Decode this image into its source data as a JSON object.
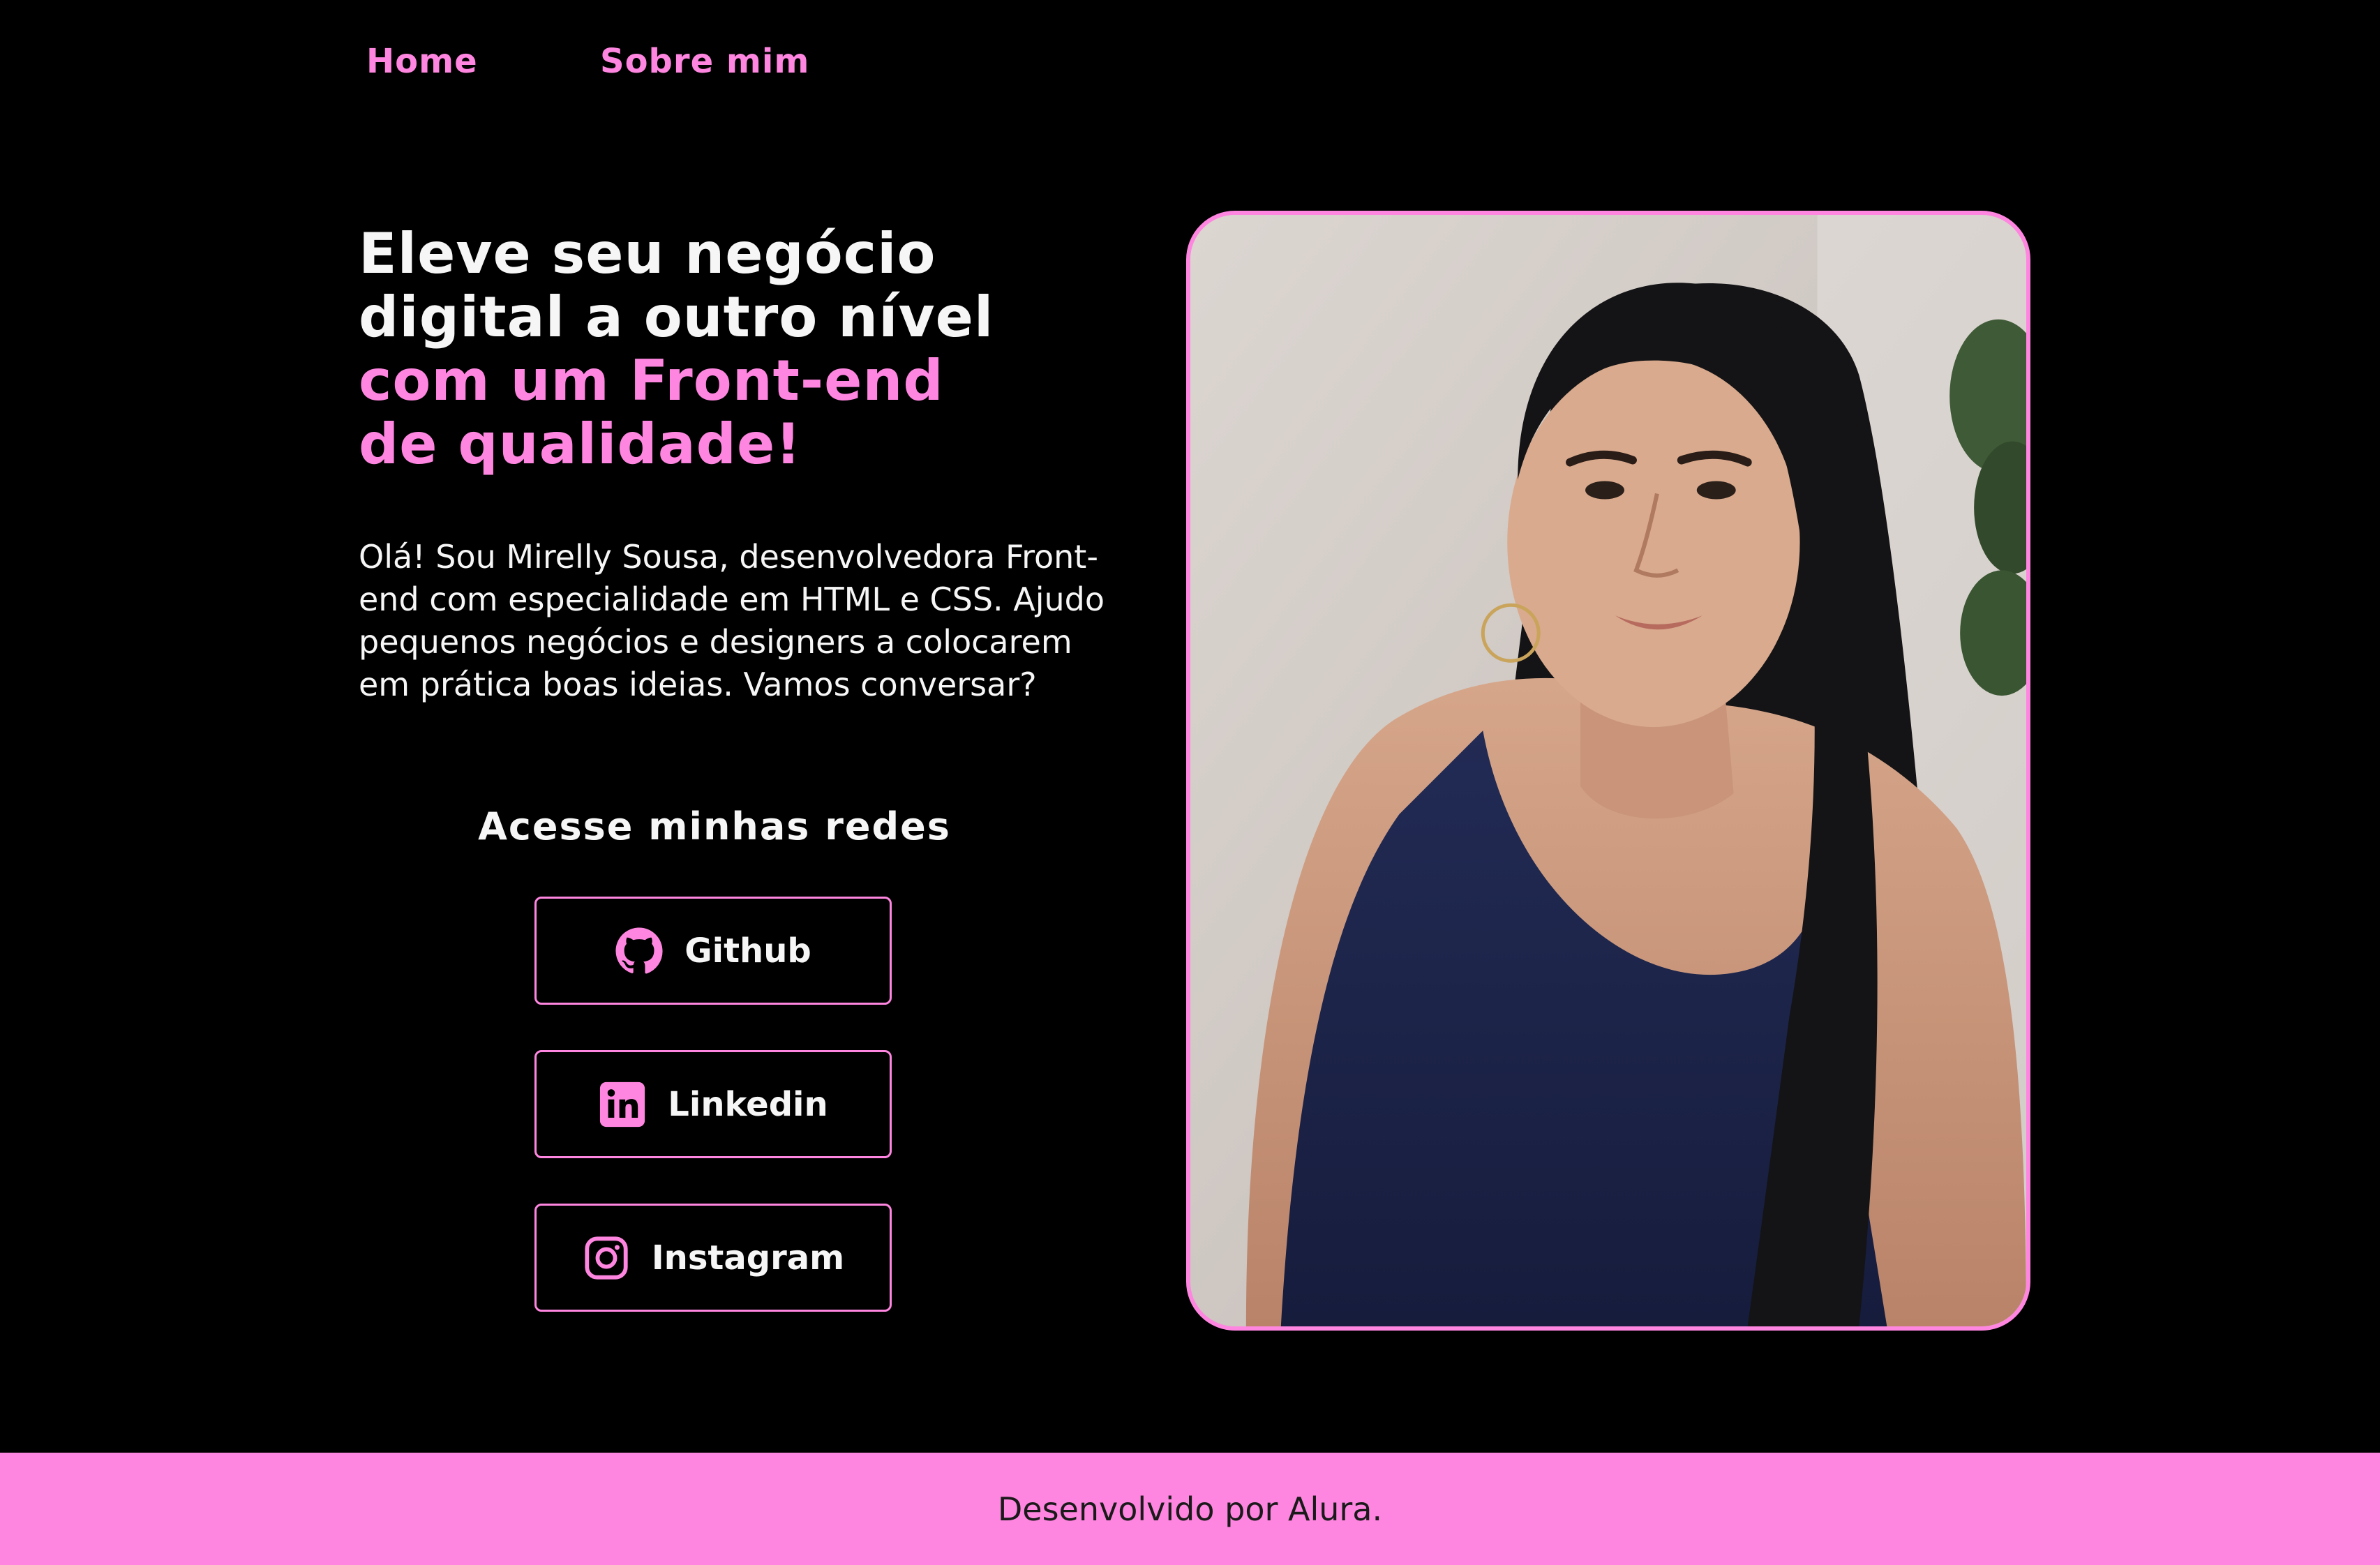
{
  "nav": {
    "home_label": "Home",
    "about_label": "Sobre mim"
  },
  "hero": {
    "headline_line1": "Eleve seu negócio",
    "headline_line2": "digital a outro nível",
    "headline_line3": "com um Front-end",
    "headline_line4": "de qualidade!",
    "intro": "Olá! Sou Mirelly Sousa, desenvolvedora Front-end com especialidade em HTML e CSS. Ajudo pequenos negócios e designers a colocarem em prática boas ideias. Vamos conversar?"
  },
  "networks": {
    "title": "Acesse minhas redes",
    "items": [
      {
        "label": "Github",
        "icon": "github-icon"
      },
      {
        "label": "Linkedin",
        "icon": "linkedin-icon"
      },
      {
        "label": "Instagram",
        "icon": "instagram-icon"
      }
    ]
  },
  "portrait": {
    "icon": "profile-photo"
  },
  "footer": {
    "text": "Desenvolvido por Alura."
  },
  "colors": {
    "accent": "#FF86E0",
    "background": "#000000",
    "text": "#F6F6F6"
  }
}
